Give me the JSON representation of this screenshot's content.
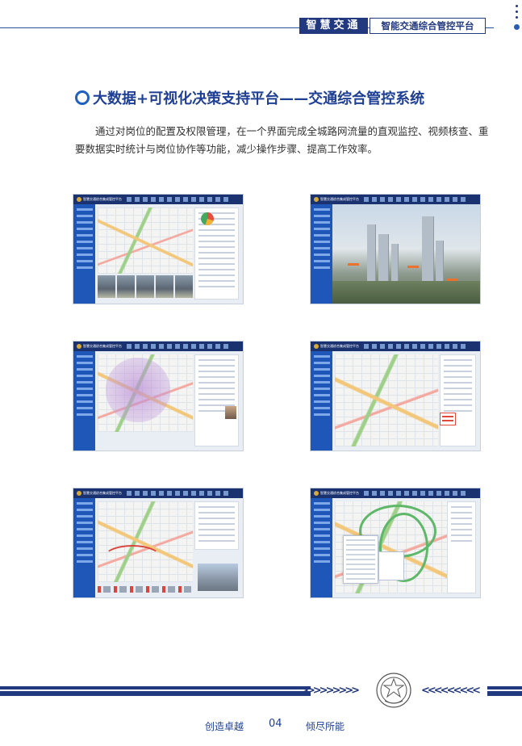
{
  "header": {
    "brand": "智慧交通",
    "platform": "智能交通综合管控平台"
  },
  "section": {
    "title": "大数据+可视化决策支持平台——交通综合管控系统",
    "intro": "通过对岗位的配置及权限管理，在一个界面完成全城路网流量的直观监控、视频核查、重要数据实时统计与岗位协作等功能，减少操作步骤、提高工作效率。"
  },
  "screenshots": {
    "app_title": "智慧交通综合集成管控平台"
  },
  "footer": {
    "left_motto": "创造卓越",
    "page_number": "04",
    "right_motto": "倾尽所能",
    "chevrons_right": ">>>>>>>>>",
    "chevrons_left": "<<<<<<<<<"
  },
  "colors": {
    "brand_navy": "#23397f",
    "title_blue": "#1e3f93",
    "accent_blue": "#1e5fc0"
  }
}
